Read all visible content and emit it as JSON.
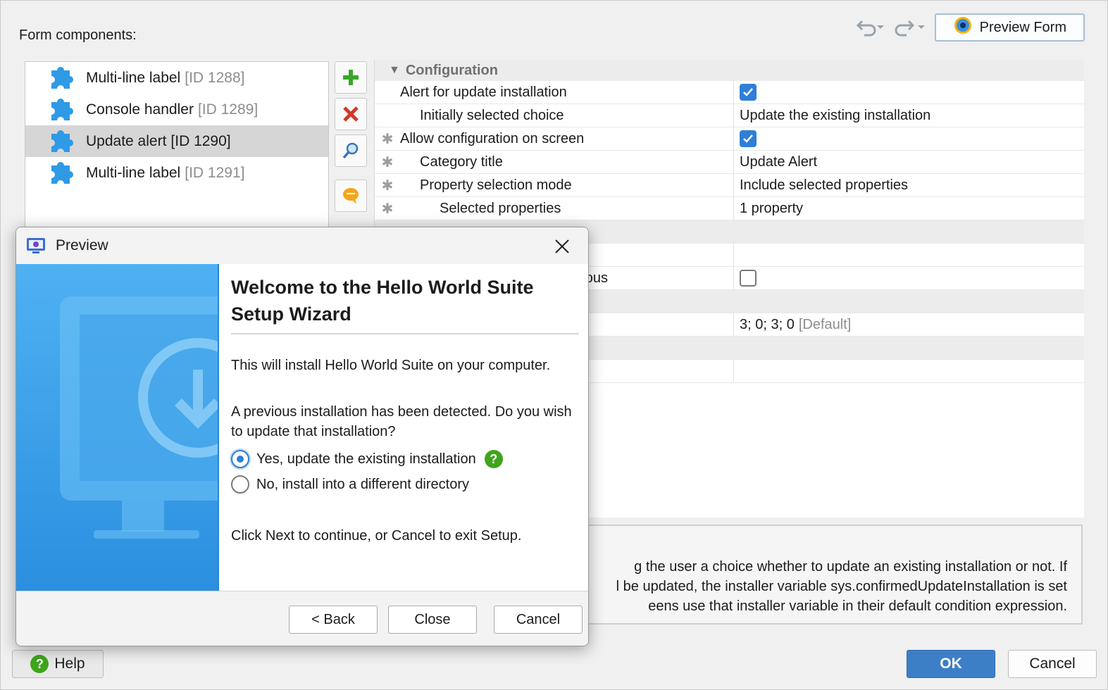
{
  "main": {
    "form_components_label": "Form components:",
    "preview_form_label": "Preview Form",
    "help_label": "Help",
    "ok_label": "OK",
    "cancel_label": "Cancel"
  },
  "components": [
    {
      "name": "Multi-line label",
      "id": "[ID 1288]"
    },
    {
      "name": "Console handler",
      "id": "[ID 1289]"
    },
    {
      "name": "Update alert",
      "id": "[ID 1290]",
      "selected": true
    },
    {
      "name": "Multi-line label",
      "id": "[ID 1291]"
    }
  ],
  "properties": {
    "section_title": "Configuration",
    "rows": [
      {
        "name": "Alert for update installation",
        "value": ""
      },
      {
        "name": "Initially selected choice",
        "value": "Update the existing installation"
      },
      {
        "name": "Allow configuration on screen",
        "value": ""
      },
      {
        "name": "Category title",
        "value": "Update Alert"
      },
      {
        "name": "Property selection mode",
        "value": "Include selected properties"
      },
      {
        "name": "Selected properties",
        "value": "1 property"
      },
      {
        "name": "ous",
        "value": ""
      },
      {
        "name": "",
        "value": "3; 0; 3; 0",
        "extra": "[Default]"
      }
    ]
  },
  "description": {
    "lines": [
      "g the user a choice whether to update an existing installation or not. If",
      "l be updated, the installer variable sys.confirmedUpdateInstallation is set",
      "eens use that installer variable in their default condition expression."
    ]
  },
  "preview": {
    "title": "Preview",
    "heading": "Welcome to the Hello World Suite Setup Wizard",
    "intro": "This will install Hello World Suite on your computer.",
    "question": "A previous installation has been detected. Do you wish to update that installation?",
    "option_yes": "Yes, update the existing installation",
    "option_no": "No, install into a different directory",
    "footer_text": "Click Next to continue, or Cancel to exit Setup.",
    "back_label": "< Back",
    "close_label": "Close",
    "cancel_label": "Cancel"
  },
  "colors": {
    "accent": "#2f7ed8",
    "ok_button": "#3c7fc7",
    "sidebar_blue": "#3da3ec"
  }
}
